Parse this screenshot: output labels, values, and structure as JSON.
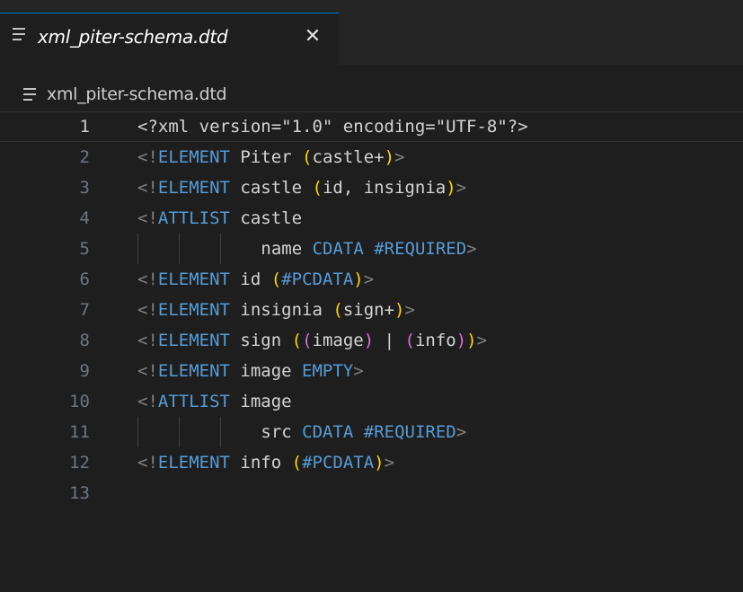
{
  "tab": {
    "title": "xml_piter-schema.dtd",
    "close_glyph": "✕",
    "icon": "file-lines-icon",
    "active_border_color": "#0078d4"
  },
  "breadcrumb": {
    "label": "xml_piter-schema.dtd",
    "icon": "file-lines-icon"
  },
  "editor": {
    "current_line": 1,
    "colors": {
      "keyword": "#569cd6",
      "bracket_level1": "#ffd700",
      "bracket_level2": "#da70d6",
      "punctuation": "#808080",
      "text": "#d4d4d4"
    },
    "lines": [
      {
        "n": "1",
        "tokens": [
          {
            "t": "<?xml version=\"1.0\" encoding=\"UTF-8\"?>",
            "c": "x"
          }
        ]
      },
      {
        "n": "2",
        "tokens": [
          {
            "t": "<!",
            "c": "brk"
          },
          {
            "t": "ELEMENT",
            "c": "kw"
          },
          {
            "t": " Piter ",
            "c": "id"
          },
          {
            "t": "(",
            "c": "p1"
          },
          {
            "t": "castle+",
            "c": "id"
          },
          {
            "t": ")",
            "c": "p1"
          },
          {
            "t": ">",
            "c": "brk"
          }
        ]
      },
      {
        "n": "3",
        "tokens": [
          {
            "t": "<!",
            "c": "brk"
          },
          {
            "t": "ELEMENT",
            "c": "kw"
          },
          {
            "t": " castle ",
            "c": "id"
          },
          {
            "t": "(",
            "c": "p1"
          },
          {
            "t": "id, insignia",
            "c": "id"
          },
          {
            "t": ")",
            "c": "p1"
          },
          {
            "t": ">",
            "c": "brk"
          }
        ]
      },
      {
        "n": "4",
        "tokens": [
          {
            "t": "<!",
            "c": "brk"
          },
          {
            "t": "ATTLIST",
            "c": "kw"
          },
          {
            "t": " castle",
            "c": "id"
          }
        ]
      },
      {
        "n": "5",
        "indent": true,
        "tokens": [
          {
            "t": "name ",
            "c": "id"
          },
          {
            "t": "CDATA #REQUIRED",
            "c": "kw"
          },
          {
            "t": ">",
            "c": "brk"
          }
        ]
      },
      {
        "n": "6",
        "tokens": [
          {
            "t": "<!",
            "c": "brk"
          },
          {
            "t": "ELEMENT",
            "c": "kw"
          },
          {
            "t": " id ",
            "c": "id"
          },
          {
            "t": "(",
            "c": "p1"
          },
          {
            "t": "#PCDATA",
            "c": "kw"
          },
          {
            "t": ")",
            "c": "p1"
          },
          {
            "t": ">",
            "c": "brk"
          }
        ]
      },
      {
        "n": "7",
        "tokens": [
          {
            "t": "<!",
            "c": "brk"
          },
          {
            "t": "ELEMENT",
            "c": "kw"
          },
          {
            "t": " insignia ",
            "c": "id"
          },
          {
            "t": "(",
            "c": "p1"
          },
          {
            "t": "sign+",
            "c": "id"
          },
          {
            "t": ")",
            "c": "p1"
          },
          {
            "t": ">",
            "c": "brk"
          }
        ]
      },
      {
        "n": "8",
        "tokens": [
          {
            "t": "<!",
            "c": "brk"
          },
          {
            "t": "ELEMENT",
            "c": "kw"
          },
          {
            "t": " sign ",
            "c": "id"
          },
          {
            "t": "(",
            "c": "p1"
          },
          {
            "t": "(",
            "c": "p2"
          },
          {
            "t": "image",
            "c": "id"
          },
          {
            "t": ")",
            "c": "p2"
          },
          {
            "t": " | ",
            "c": "id"
          },
          {
            "t": "(",
            "c": "p2"
          },
          {
            "t": "info",
            "c": "id"
          },
          {
            "t": ")",
            "c": "p2"
          },
          {
            "t": ")",
            "c": "p1"
          },
          {
            "t": ">",
            "c": "brk"
          }
        ]
      },
      {
        "n": "9",
        "tokens": [
          {
            "t": "<!",
            "c": "brk"
          },
          {
            "t": "ELEMENT",
            "c": "kw"
          },
          {
            "t": " image ",
            "c": "id"
          },
          {
            "t": "EMPTY",
            "c": "kw"
          },
          {
            "t": ">",
            "c": "brk"
          }
        ]
      },
      {
        "n": "10",
        "tokens": [
          {
            "t": "<!",
            "c": "brk"
          },
          {
            "t": "ATTLIST",
            "c": "kw"
          },
          {
            "t": " image",
            "c": "id"
          }
        ]
      },
      {
        "n": "11",
        "indent": true,
        "tokens": [
          {
            "t": "src ",
            "c": "id"
          },
          {
            "t": "CDATA #REQUIRED",
            "c": "kw"
          },
          {
            "t": ">",
            "c": "brk"
          }
        ]
      },
      {
        "n": "12",
        "tokens": [
          {
            "t": "<!",
            "c": "brk"
          },
          {
            "t": "ELEMENT",
            "c": "kw"
          },
          {
            "t": " info ",
            "c": "id"
          },
          {
            "t": "(",
            "c": "p1"
          },
          {
            "t": "#PCDATA",
            "c": "kw"
          },
          {
            "t": ")",
            "c": "p1"
          },
          {
            "t": ">",
            "c": "brk"
          }
        ]
      },
      {
        "n": "13",
        "tokens": []
      }
    ]
  }
}
